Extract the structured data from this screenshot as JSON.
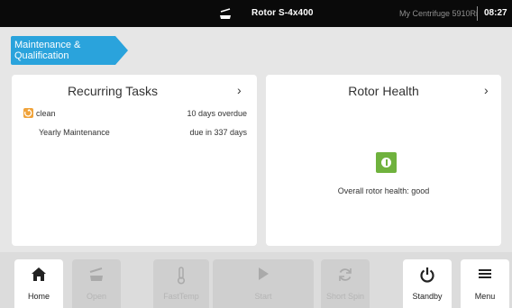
{
  "topbar": {
    "rotor_title": "Rotor S-4x400",
    "device_name": "My Centrifuge 5910Ri",
    "clock": "08:27"
  },
  "breadcrumb": {
    "label": "Maintenance & Qualification",
    "color": "#2aa3dc"
  },
  "recurring_tasks": {
    "title": "Recurring Tasks",
    "chevron": "›",
    "tasks": [
      {
        "name": "clean",
        "due": "10 days overdue",
        "icon": "warning-icon"
      },
      {
        "name": "Yearly Maintenance",
        "due": "due in 337 days"
      }
    ]
  },
  "rotor_health": {
    "title": "Rotor Health",
    "chevron": "›",
    "status_text": "Overall rotor health: good",
    "status_color": "#6fb23d"
  },
  "bottombar": {
    "buttons": [
      {
        "label": "Home",
        "icon": "home-icon",
        "state": "active"
      },
      {
        "label": "Open",
        "icon": "lid-icon",
        "state": "disabled"
      },
      {
        "label": "FastTemp",
        "icon": "thermometer-icon",
        "state": "disabled"
      },
      {
        "label": "Start",
        "icon": "play-icon",
        "state": "disabled"
      },
      {
        "label": "Short Spin",
        "icon": "spin-icon",
        "state": "disabled"
      },
      {
        "label": "Standby",
        "icon": "power-icon",
        "state": "active"
      },
      {
        "label": "Menu",
        "icon": "menu-icon",
        "state": "active"
      }
    ]
  },
  "colors": {
    "background": "#e6e6e6",
    "topbar": "#0a0a0a",
    "warning": "#f0a33a"
  }
}
